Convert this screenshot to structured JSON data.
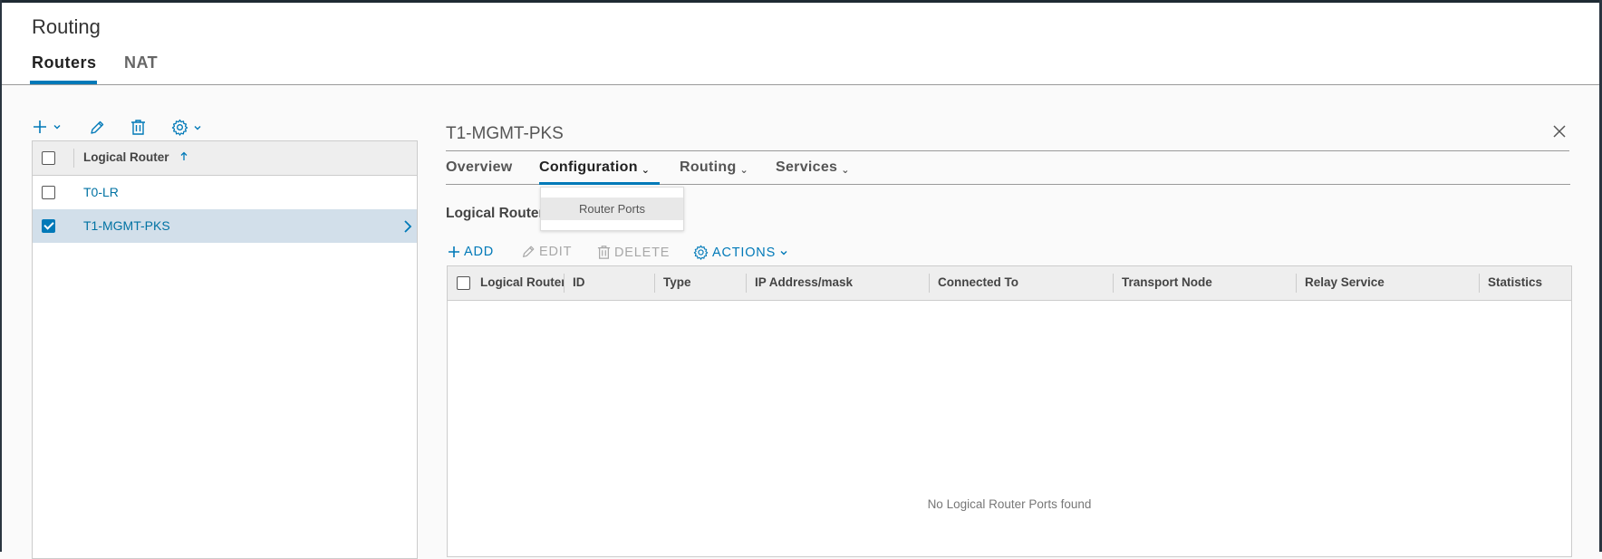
{
  "page": {
    "title": "Routing",
    "tabs": [
      {
        "label": "Routers",
        "active": true
      },
      {
        "label": "NAT",
        "active": false
      }
    ]
  },
  "toolbar": {
    "icons": [
      "plus-icon",
      "chevron-down-icon",
      "pencil-icon",
      "trash-icon",
      "gear-icon",
      "chevron-down-icon"
    ]
  },
  "router_list": {
    "header": "Logical Router",
    "sort_icon": "arrow-up-icon",
    "rows": [
      {
        "name": "T0-LR",
        "selected": false
      },
      {
        "name": "T1-MGMT-PKS",
        "selected": true
      }
    ]
  },
  "detail": {
    "title": "T1-MGMT-PKS",
    "tabs": [
      {
        "label": "Overview",
        "has_menu": false
      },
      {
        "label": "Configuration",
        "has_menu": true,
        "active": true
      },
      {
        "label": "Routing",
        "has_menu": true
      },
      {
        "label": "Services",
        "has_menu": true
      }
    ],
    "dropdown": {
      "items": [
        "Router Ports"
      ]
    },
    "section_heading": "Logical Router Ports",
    "actions": {
      "add": "ADD",
      "edit": "EDIT",
      "delete": "DELETE",
      "actions": "ACTIONS"
    },
    "columns": [
      "Logical Router Port",
      "ID",
      "Type",
      "IP Address/mask",
      "Connected To",
      "Transport Node",
      "Relay Service",
      "Statistics"
    ],
    "empty_message": "No Logical Router Ports found"
  },
  "colors": {
    "accent": "#0079b8",
    "link": "#0072a3",
    "selected_row": "#d2dfea",
    "header_bg": "#eeeeee"
  }
}
